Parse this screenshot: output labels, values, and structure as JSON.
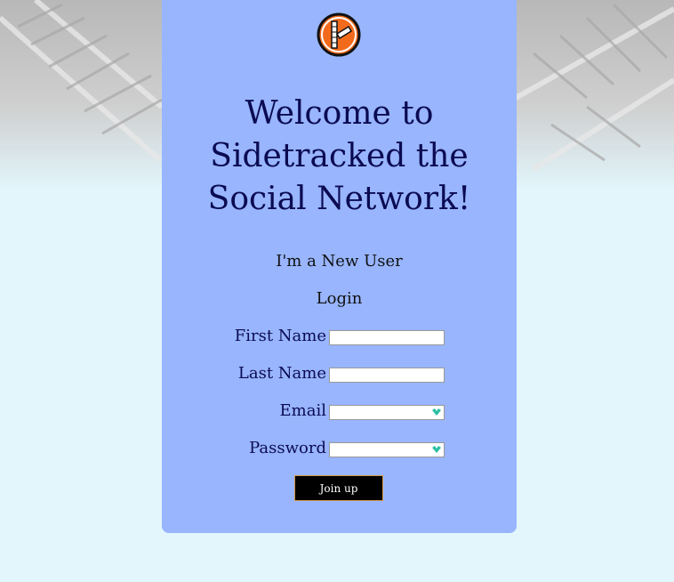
{
  "page": {
    "logo_icon": "sidetracked-logo-icon",
    "title_line1": "Welcome to",
    "title_line2": "Sidetracked the",
    "title_line3": "Social Network!",
    "new_user_link": "I'm a New User",
    "login_link": "Login"
  },
  "form": {
    "first_name_label": "First Name",
    "last_name_label": "Last Name",
    "email_label": "Email",
    "password_label": "Password",
    "first_name_value": "",
    "last_name_value": "",
    "email_value": "",
    "password_value": "",
    "submit_label": "Join up"
  },
  "colors": {
    "card_bg": "#98b5fe",
    "page_bg": "#e2f6fc",
    "title_color": "#0b0b52",
    "button_bg": "#000000"
  }
}
